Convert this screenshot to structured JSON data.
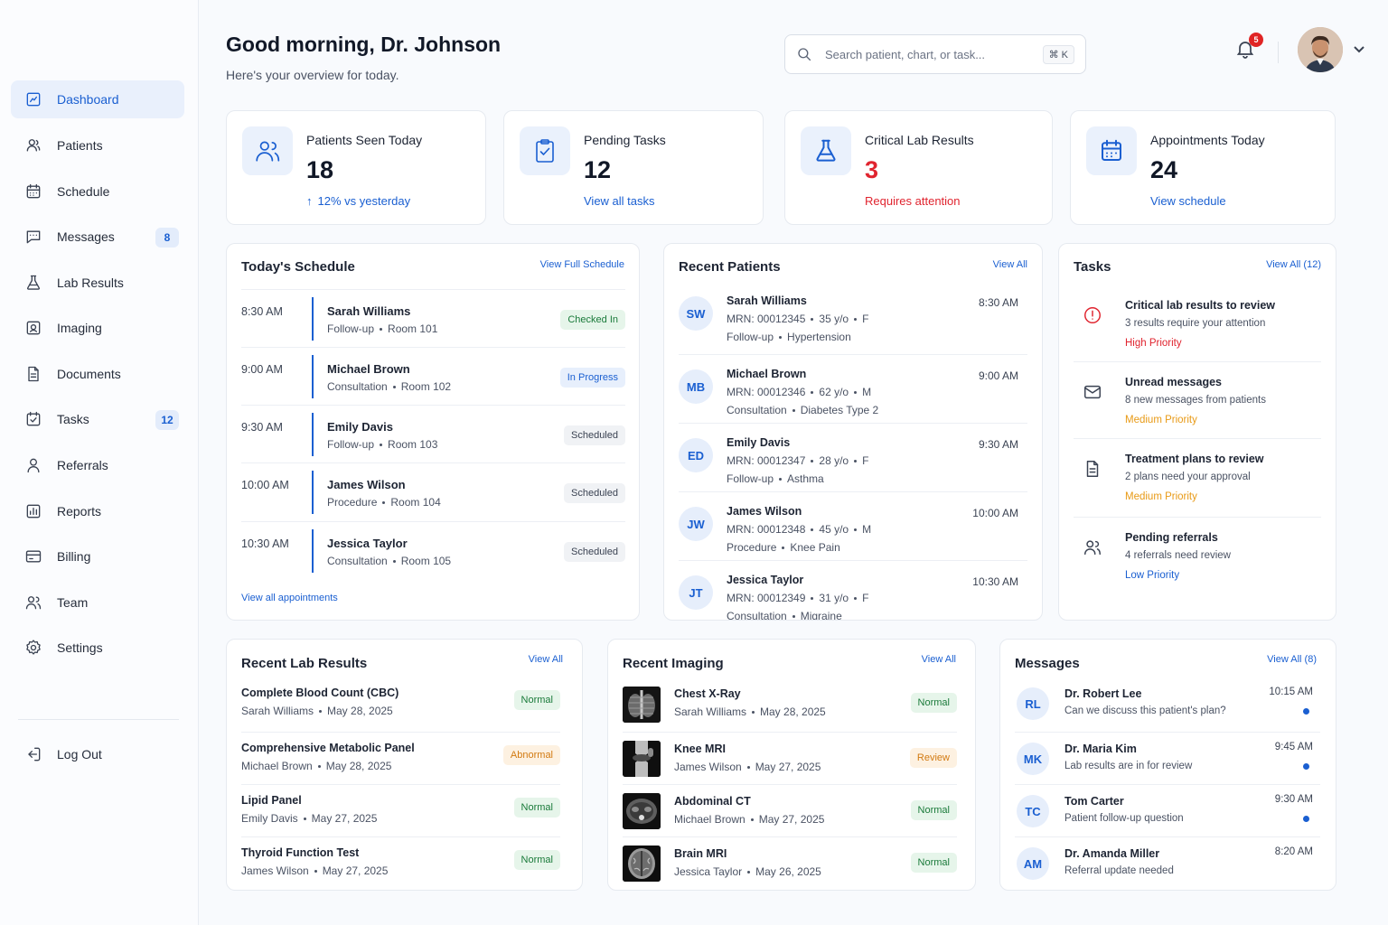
{
  "sidebar": {
    "items": [
      {
        "label": "Dashboard",
        "icon": "dashboard-icon",
        "active": true
      },
      {
        "label": "Patients",
        "icon": "patients-icon"
      },
      {
        "label": "Schedule",
        "icon": "calendar-icon"
      },
      {
        "label": "Messages",
        "icon": "message-icon",
        "badge": "8"
      },
      {
        "label": "Lab Results",
        "icon": "flask-icon"
      },
      {
        "label": "Imaging",
        "icon": "image-icon"
      },
      {
        "label": "Documents",
        "icon": "document-icon"
      },
      {
        "label": "Tasks",
        "icon": "task-icon",
        "badge": "12"
      },
      {
        "label": "Referrals",
        "icon": "person-icon"
      },
      {
        "label": "Reports",
        "icon": "chart-icon"
      },
      {
        "label": "Billing",
        "icon": "card-icon"
      },
      {
        "label": "Team",
        "icon": "team-icon"
      },
      {
        "label": "Settings",
        "icon": "gear-icon"
      }
    ],
    "logout": "Log Out"
  },
  "header": {
    "greeting": "Good morning, Dr. Johnson",
    "subtitle": "Here's your overview for today.",
    "search_placeholder": "Search patient, chart, or task...",
    "search_shortcut": "⌘ K",
    "notification_count": "5"
  },
  "stats": [
    {
      "title": "Patients Seen Today",
      "value": "18",
      "sub": "12% vs yesterday",
      "icon": "users-icon"
    },
    {
      "title": "Pending Tasks",
      "value": "12",
      "sub": "View all tasks",
      "icon": "clipboard-check-icon"
    },
    {
      "title": "Critical Lab Results",
      "value": "3",
      "sub": "Requires attention",
      "icon": "flask-icon"
    },
    {
      "title": "Appointments Today",
      "value": "24",
      "sub": "View schedule",
      "icon": "calendar-icon"
    }
  ],
  "schedule": {
    "title": "Today's Schedule",
    "link": "View Full Schedule",
    "footer_link": "View all appointments",
    "rows": [
      {
        "time": "8:30 AM",
        "name": "Sarah Williams",
        "type": "Follow-up",
        "room": "Room 101",
        "status": "Checked In",
        "color": "green"
      },
      {
        "time": "9:00 AM",
        "name": "Michael Brown",
        "type": "Consultation",
        "room": "Room 102",
        "status": "In Progress",
        "color": "blue"
      },
      {
        "time": "9:30 AM",
        "name": "Emily Davis",
        "type": "Follow-up",
        "room": "Room 103",
        "status": "Scheduled",
        "color": "gray"
      },
      {
        "time": "10:00 AM",
        "name": "James Wilson",
        "type": "Procedure",
        "room": "Room 104",
        "status": "Scheduled",
        "color": "gray"
      },
      {
        "time": "10:30 AM",
        "name": "Jessica Taylor",
        "type": "Consultation",
        "room": "Room 105",
        "status": "Scheduled",
        "color": "gray"
      }
    ]
  },
  "recent_patients": {
    "title": "Recent Patients",
    "link": "View All",
    "rows": [
      {
        "initials": "SW",
        "name": "Sarah Williams",
        "mrn": "MRN: 00012345",
        "age": "35 y/o",
        "sex": "F",
        "visit": "Follow-up",
        "condition": "Hypertension",
        "time": "8:30 AM"
      },
      {
        "initials": "MB",
        "name": "Michael Brown",
        "mrn": "MRN: 00012346",
        "age": "62 y/o",
        "sex": "M",
        "visit": "Consultation",
        "condition": "Diabetes Type 2",
        "time": "9:00 AM"
      },
      {
        "initials": "ED",
        "name": "Emily Davis",
        "mrn": "MRN: 00012347",
        "age": "28 y/o",
        "sex": "F",
        "visit": "Follow-up",
        "condition": "Asthma",
        "time": "9:30 AM"
      },
      {
        "initials": "JW",
        "name": "James Wilson",
        "mrn": "MRN: 00012348",
        "age": "45 y/o",
        "sex": "M",
        "visit": "Procedure",
        "condition": "Knee Pain",
        "time": "10:00 AM"
      },
      {
        "initials": "JT",
        "name": "Jessica Taylor",
        "mrn": "MRN: 00012349",
        "age": "31 y/o",
        "sex": "F",
        "visit": "Consultation",
        "condition": "Migraine",
        "time": "10:30 AM"
      }
    ]
  },
  "tasks": {
    "title": "Tasks",
    "link": "View All (12)",
    "rows": [
      {
        "icon": "alert-icon",
        "title": "Critical lab results to review",
        "desc": "3 results require your attention",
        "priority": "High Priority",
        "color": "#e0242f"
      },
      {
        "icon": "mail-icon",
        "title": "Unread messages",
        "desc": "8 new messages from patients",
        "priority": "Medium Priority",
        "color": "#e89a16"
      },
      {
        "icon": "document-icon",
        "title": "Treatment plans to review",
        "desc": "2 plans need your approval",
        "priority": "Medium Priority",
        "color": "#e89a16"
      },
      {
        "icon": "team-icon",
        "title": "Pending referrals",
        "desc": "4 referrals need review",
        "priority": "Low Priority",
        "color": "#1a5fd1"
      }
    ]
  },
  "labs": {
    "title": "Recent Lab Results",
    "link": "View All",
    "rows": [
      {
        "name": "Complete Blood Count (CBC)",
        "patient": "Sarah Williams",
        "date": "May 28, 2025",
        "status": "Normal",
        "color": "green"
      },
      {
        "name": "Comprehensive Metabolic Panel",
        "patient": "Michael Brown",
        "date": "May 28, 2025",
        "status": "Abnormal",
        "color": "orange"
      },
      {
        "name": "Lipid Panel",
        "patient": "Emily Davis",
        "date": "May 27, 2025",
        "status": "Normal",
        "color": "green"
      },
      {
        "name": "Thyroid Function Test",
        "patient": "James Wilson",
        "date": "May 27, 2025",
        "status": "Normal",
        "color": "green"
      }
    ]
  },
  "imaging": {
    "title": "Recent Imaging",
    "link": "View All",
    "rows": [
      {
        "name": "Chest X-Ray",
        "patient": "Sarah Williams",
        "date": "May 28, 2025",
        "status": "Normal",
        "color": "green",
        "kind": "chest"
      },
      {
        "name": "Knee MRI",
        "patient": "James Wilson",
        "date": "May 27, 2025",
        "status": "Review",
        "color": "orange",
        "kind": "knee"
      },
      {
        "name": "Abdominal CT",
        "patient": "Michael Brown",
        "date": "May 27, 2025",
        "status": "Normal",
        "color": "green",
        "kind": "ct"
      },
      {
        "name": "Brain MRI",
        "patient": "Jessica Taylor",
        "date": "May 26, 2025",
        "status": "Normal",
        "color": "green",
        "kind": "brain"
      }
    ]
  },
  "messages": {
    "title": "Messages",
    "link": "View All (8)",
    "rows": [
      {
        "initials": "RL",
        "name": "Dr. Robert Lee",
        "text": "Can we discuss this patient's plan?",
        "time": "10:15 AM",
        "unread": true
      },
      {
        "initials": "MK",
        "name": "Dr. Maria Kim",
        "text": "Lab results are in for review",
        "time": "9:45 AM",
        "unread": true
      },
      {
        "initials": "TC",
        "name": "Tom Carter",
        "text": "Patient follow-up question",
        "time": "9:30 AM",
        "unread": true
      },
      {
        "initials": "AM",
        "name": "Dr. Amanda Miller",
        "text": "Referral update needed",
        "time": "8:20 AM",
        "unread": false
      }
    ]
  }
}
